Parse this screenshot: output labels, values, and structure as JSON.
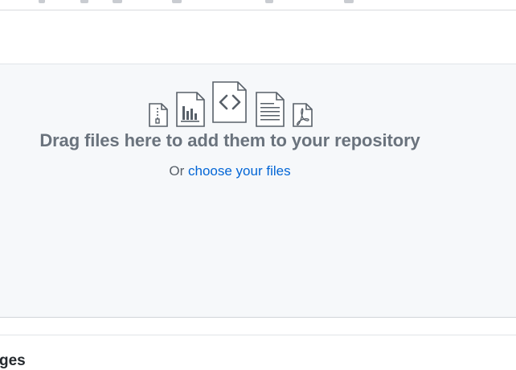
{
  "dropzone": {
    "title": "Drag files here to add them to your repository",
    "prompt_prefix": "Or",
    "choose_link": "choose your files",
    "file_type_icons": [
      "zip-file-icon",
      "chart-file-icon",
      "code-file-icon",
      "text-file-icon",
      "pdf-file-icon"
    ]
  },
  "commit_section": {
    "heading_fragment": "ges"
  },
  "colors": {
    "link": "#0366d6",
    "dropzone_bg": "#f6f8fa",
    "muted_text": "#6a737d"
  }
}
